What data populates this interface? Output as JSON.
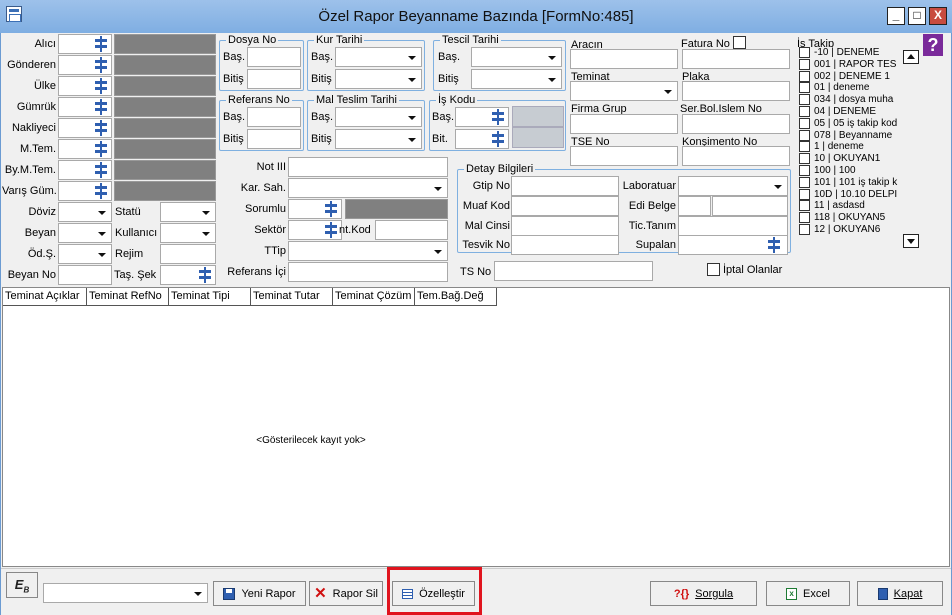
{
  "window": {
    "title": "Özel Rapor Beyanname Bazında [FormNo:485]"
  },
  "left_labels": [
    "Alıcı",
    "Gönderen",
    "Ülke",
    "Gümrük",
    "Nakliyeci",
    "M.Tem.",
    "By.M.Tem.",
    "Varış Güm."
  ],
  "doviz": {
    "doviz": "Döviz",
    "statu": "Statü",
    "beyan": "Beyan",
    "kullanici": "Kullanıcı",
    "ods": "Öd.Ş.",
    "rejim": "Rejim",
    "beyanno": "Beyan No",
    "tas": "Taş. Şek"
  },
  "dosya": {
    "title": "Dosya No",
    "bas": "Baş.",
    "bitis": "Bitiş"
  },
  "kur": {
    "title": "Kur Tarihi",
    "bas": "Baş.",
    "bitis": "Bitiş"
  },
  "tescil": {
    "title": "Tescil Tarihi",
    "bas": "Baş.",
    "bitis": "Bitiş"
  },
  "referans": {
    "title": "Referans No",
    "bas": "Baş.",
    "bitis": "Bitiş"
  },
  "mal": {
    "title": "Mal Teslim Tarihi",
    "bas": "Baş.",
    "bitis": "Bitiş"
  },
  "iskodu": {
    "title": "İş Kodu",
    "bas": "Baş.",
    "bit": "Bit."
  },
  "mid": {
    "not": "Not III",
    "kar": "Kar. Sah.",
    "sorumlu": "Sorumlu",
    "sektor": "Sektör",
    "intkod": "nt.Kod",
    "ttip": "TTip",
    "ref": "Referans İçi"
  },
  "right": {
    "aracin": "Aracın",
    "fatura": "Fatura No",
    "teminat": "Teminat",
    "plaka": "Plaka",
    "firma": "Firma Grup",
    "ser": "Ser.Bol.Islem No",
    "tse": "TSE No",
    "kons": "Konşimento No"
  },
  "detay": {
    "title": "Detay Bilgileri",
    "gtip": "Gtip No",
    "lab": "Laboratuar",
    "muaf": "Muaf Kod",
    "edi": "Edi Belge",
    "mal": "Mal Cinsi",
    "tic": "Tic.Tanım",
    "tesvik": "Tesvik No",
    "supalan": "Supalan"
  },
  "tsno": "TS No",
  "iptal": "İptal Olanlar",
  "istakip": {
    "title": "İş Takip",
    "items": [
      "-10 | DENEME",
      "001 | RAPOR TES",
      "002 | DENEME 1",
      "01 | deneme",
      "034 | dosya muha",
      "04 | DENEME",
      "05 | 05 iş takip kod",
      "078 | Beyanname",
      "1 | deneme",
      "10 | OKUYAN1",
      "100 | 100",
      "101 | 101 iş takip k",
      "10D | 10.10 DELPI",
      "11 | asdasd",
      "118 | OKUYAN5",
      "12 | OKUYAN6"
    ]
  },
  "grid": {
    "columns": [
      "Teminat Açıklar",
      "Teminat RefNo",
      "Teminat Tipi",
      "Teminat Tutar",
      "Teminat Çözüm",
      "Tem.Bağ.Değ"
    ],
    "empty": "<Gösterilecek kayıt yok>"
  },
  "buttons": {
    "yeni": "Yeni Rapor",
    "sil": "Rapor Sil",
    "ozel": "Özelleştir",
    "sorgula": "Sorgula",
    "excel": "Excel",
    "kapat": "Kapat"
  },
  "help": "?",
  "colors": {
    "title_bg": "#86b3e4",
    "highlight": "#e0141e",
    "accent": "#2f5fb0"
  }
}
